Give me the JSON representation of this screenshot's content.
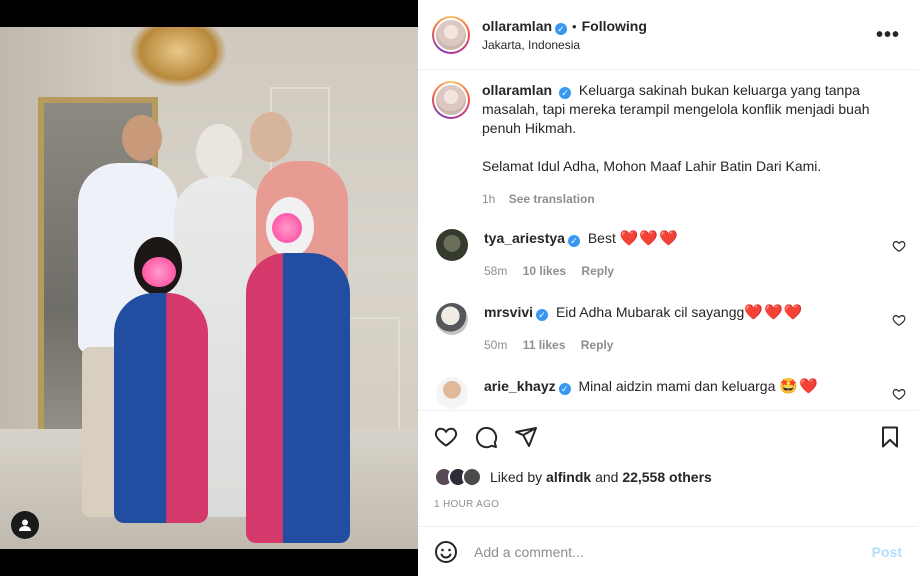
{
  "post": {
    "username": "ollaramlan",
    "follow_status": "Following",
    "separator": "•",
    "location": "Jakarta, Indonesia",
    "more_icon": "more-horizontal-icon"
  },
  "caption": {
    "username": "ollaramlan",
    "text": "Keluarga sakinah bukan keluarga yang tanpa masalah, tapi mereka terampil mengelola konflik menjadi buah penuh Hikmah.",
    "text2": "Selamat Idul Adha, Mohon Maaf Lahir Batin Dari Kami.",
    "time": "1h",
    "see_translation": "See translation"
  },
  "comments": [
    {
      "username": "tya_ariestya",
      "text": "Best",
      "emoji": "❤️❤️❤️",
      "time": "58m",
      "likes": "10 likes",
      "reply": "Reply"
    },
    {
      "username": "mrsvivi",
      "text": "Eid Adha Mubarak cil sayangg",
      "emoji": "❤️❤️❤️",
      "time": "50m",
      "likes": "11 likes",
      "reply": "Reply"
    },
    {
      "username": "arie_khayz",
      "text": "Minal aidzin mami dan keluarga",
      "emoji": "🤩❤️"
    }
  ],
  "actions": {
    "liked_by_prefix": "Liked by",
    "liked_by_user": "alfindk",
    "and": "and",
    "others": "22,558 others",
    "timestamp": "1 HOUR AGO"
  },
  "add_comment": {
    "placeholder": "Add a comment...",
    "post_label": "Post"
  },
  "colors": {
    "verified": "#3897f0",
    "post_button": "#b2dffc",
    "heart": "#e0162b"
  }
}
